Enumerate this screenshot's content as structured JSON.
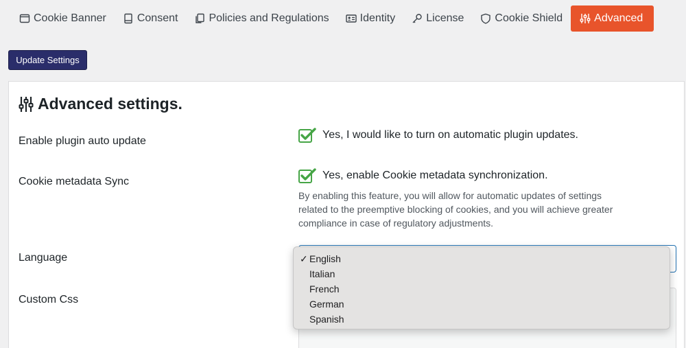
{
  "tabs": [
    {
      "label": "Cookie Banner",
      "icon": "window-icon"
    },
    {
      "label": "Consent",
      "icon": "book-icon"
    },
    {
      "label": "Policies and Regulations",
      "icon": "copy-icon"
    },
    {
      "label": "Identity",
      "icon": "id-card-icon"
    },
    {
      "label": "License",
      "icon": "key-icon"
    },
    {
      "label": "Cookie Shield",
      "icon": "shield-icon"
    },
    {
      "label": "Advanced",
      "icon": "sliders-icon",
      "active": true
    }
  ],
  "toolbar": {
    "update_label": "Update Settings"
  },
  "section": {
    "title": "Advanced settings."
  },
  "rows": {
    "auto_update": {
      "label": "Enable plugin auto update",
      "option": "Yes, I would like to turn on automatic plugin updates.",
      "checked": true
    },
    "metadata_sync": {
      "label": "Cookie metadata Sync",
      "option": "Yes, enable Cookie metadata synchronization.",
      "checked": true,
      "description": "By enabling this feature, you will allow for automatic updates of settings related to the preemptive blocking of cookies, and you will achieve greater compliance in case of regulatory adjustments."
    },
    "language": {
      "label": "Language",
      "selected": "English",
      "options": [
        "English",
        "Italian",
        "French",
        "German",
        "Spanish"
      ]
    },
    "custom_css": {
      "label": "Custom Css"
    }
  },
  "colors": {
    "accent": "#e8542b",
    "button": "#2a2d6a",
    "check": "#46a546"
  }
}
